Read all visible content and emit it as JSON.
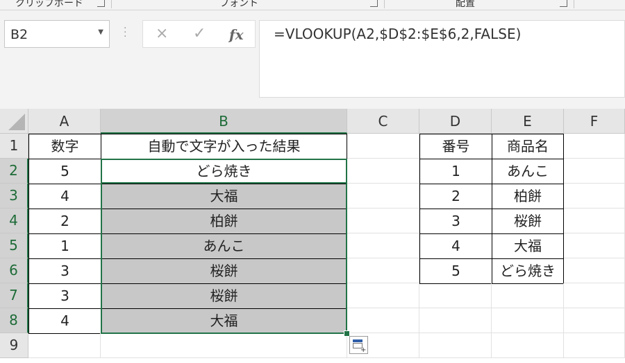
{
  "ribbon": {
    "groups": [
      "クリップボード",
      "フォント",
      "配置"
    ]
  },
  "formula_bar": {
    "name_box": "B2",
    "cancel_icon": "×",
    "enter_icon": "✓",
    "fx_label": "fx",
    "formula": "=VLOOKUP(A2,$D$2:$E$6,2,FALSE)"
  },
  "columns": [
    "A",
    "B",
    "C",
    "D",
    "E",
    "F"
  ],
  "rows": [
    "1",
    "2",
    "3",
    "4",
    "5",
    "6",
    "7",
    "8",
    "9"
  ],
  "table_left": {
    "headers": [
      "数字",
      "自動で文字が入った結果"
    ],
    "rows": [
      [
        "5",
        "どら焼き"
      ],
      [
        "4",
        "大福"
      ],
      [
        "2",
        "柏餅"
      ],
      [
        "1",
        "あんこ"
      ],
      [
        "3",
        "桜餅"
      ],
      [
        "3",
        "桜餅"
      ],
      [
        "4",
        "大福"
      ]
    ]
  },
  "table_right": {
    "headers": [
      "番号",
      "商品名"
    ],
    "rows": [
      [
        "1",
        "あんこ"
      ],
      [
        "2",
        "柏餅"
      ],
      [
        "3",
        "桜餅"
      ],
      [
        "4",
        "大福"
      ],
      [
        "5",
        "どら焼き"
      ]
    ]
  },
  "colors": {
    "selection": "#217346",
    "highlight_fill": "#c8c8c8"
  }
}
